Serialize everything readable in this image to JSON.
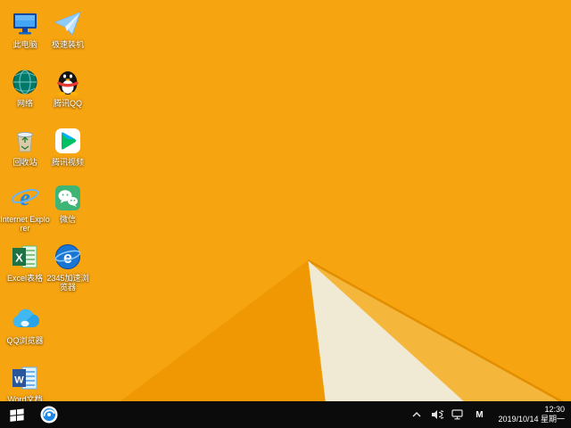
{
  "wallpaper": {
    "base_color": "#f7a411",
    "dark_wedge_color": "#ef9803",
    "cream_color": "#f0e9d4",
    "light_amber_color": "#f5b63c",
    "edge_line_color": "#e18f00"
  },
  "desktop": {
    "items": [
      {
        "label": "此电脑",
        "icon": "this-pc"
      },
      {
        "label": "极速装机",
        "icon": "paper-plane"
      },
      {
        "label": "网络",
        "icon": "network-globe"
      },
      {
        "label": "腾讯QQ",
        "icon": "qq-penguin"
      },
      {
        "label": "回收站",
        "icon": "recycle-bin"
      },
      {
        "label": "腾讯视频",
        "icon": "tencent-video"
      },
      {
        "label": "Internet Explorer",
        "icon": "internet-explorer"
      },
      {
        "label": "微信",
        "icon": "wechat"
      },
      {
        "label": "Excel表格",
        "icon": "excel"
      },
      {
        "label": "2345加速浏览器",
        "icon": "browser-2345"
      },
      {
        "label": "QQ浏览器",
        "icon": "qq-cloud"
      },
      {
        "label": "Word文档",
        "icon": "word"
      }
    ]
  },
  "taskbar": {
    "color": "#0b0b0c",
    "tray": {
      "ime_label": "M",
      "time": "12:30",
      "date": "2019/10/14 星期一"
    }
  }
}
